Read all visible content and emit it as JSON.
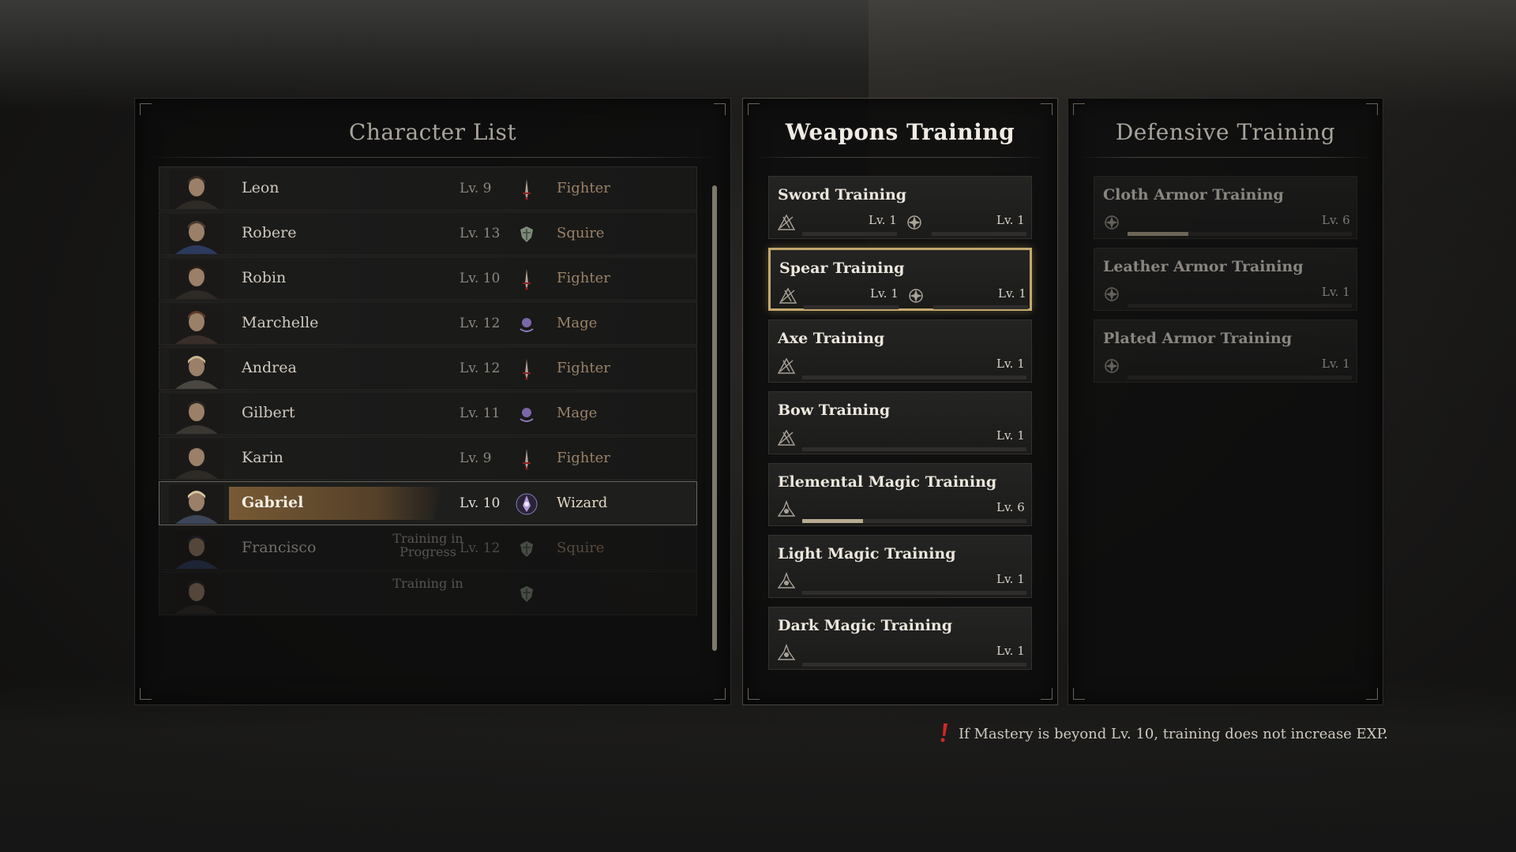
{
  "colors": {
    "selected_border": "#c4a96c",
    "selected_glow": "#96703c",
    "panel_bg": "#0c0c0c",
    "class_text": "#9a8268",
    "bar_fill": "#b8ab92",
    "warning_red": "#d02828"
  },
  "character_list": {
    "title": "Character List",
    "characters": [
      {
        "name": "Leon",
        "level": "Lv.  9",
        "class": "Fighter",
        "class_icon": "fighter-dagger-icon"
      },
      {
        "name": "Robere",
        "level": "Lv. 13",
        "class": "Squire",
        "class_icon": "squire-shield-icon"
      },
      {
        "name": "Robin",
        "level": "Lv. 10",
        "class": "Fighter",
        "class_icon": "fighter-dagger-icon"
      },
      {
        "name": "Marchelle",
        "level": "Lv. 12",
        "class": "Mage",
        "class_icon": "mage-orb-icon"
      },
      {
        "name": "Andrea",
        "level": "Lv. 12",
        "class": "Fighter",
        "class_icon": "fighter-dagger-icon"
      },
      {
        "name": "Gilbert",
        "level": "Lv.  11",
        "class": "Mage",
        "class_icon": "mage-orb-icon"
      },
      {
        "name": "Karin",
        "level": "Lv.  9",
        "class": "Fighter",
        "class_icon": "fighter-dagger-icon"
      },
      {
        "name": "Gabriel",
        "level": "Lv. 10",
        "class": "Wizard",
        "class_icon": "wizard-crest-icon",
        "selected": true
      },
      {
        "name": "Francisco",
        "level": "Lv. 12",
        "class": "Squire",
        "class_icon": "squire-shield-icon",
        "status": "Training in Progress"
      },
      {
        "name": "",
        "level": "",
        "class": "",
        "class_icon": "squire-shield-icon",
        "status": "Training in"
      }
    ]
  },
  "weapons_training": {
    "title": "Weapons Training",
    "items": [
      {
        "name": "Sword Training",
        "icon": "weapon-mastery-icon",
        "level": "Lv. 1",
        "progress": 0,
        "secondary_icon": "defense-mastery-icon",
        "secondary_level": "Lv. 1",
        "secondary_progress": 0
      },
      {
        "name": "Spear Training",
        "icon": "weapon-mastery-icon",
        "level": "Lv. 1",
        "progress": 0,
        "secondary_icon": "defense-mastery-icon",
        "secondary_level": "Lv. 1",
        "secondary_progress": 0,
        "selected": true
      },
      {
        "name": "Axe Training",
        "icon": "weapon-mastery-icon",
        "level": "Lv. 1",
        "progress": 0
      },
      {
        "name": "Bow Training",
        "icon": "weapon-mastery-icon",
        "level": "Lv. 1",
        "progress": 0
      },
      {
        "name": "Elemental Magic Training",
        "icon": "magic-mastery-icon",
        "level": "Lv. 6",
        "progress": 0.27
      },
      {
        "name": "Light Magic Training",
        "icon": "magic-mastery-icon",
        "level": "Lv. 1",
        "progress": 0
      },
      {
        "name": "Dark Magic Training",
        "icon": "magic-mastery-icon",
        "level": "Lv. 1",
        "progress": 0
      }
    ]
  },
  "defensive_training": {
    "title": "Defensive Training",
    "items": [
      {
        "name": "Cloth Armor Training",
        "icon": "defense-mastery-icon",
        "level": "Lv. 6",
        "progress": 0.27
      },
      {
        "name": "Leather Armor Training",
        "icon": "defense-mastery-icon",
        "level": "Lv. 1",
        "progress": 0
      },
      {
        "name": "Plated Armor Training",
        "icon": "defense-mastery-icon",
        "level": "Lv. 1",
        "progress": 0
      }
    ]
  },
  "notice": {
    "icon": "exclamation-icon",
    "text": "If Mastery is beyond Lv. 10, training does not increase EXP."
  }
}
